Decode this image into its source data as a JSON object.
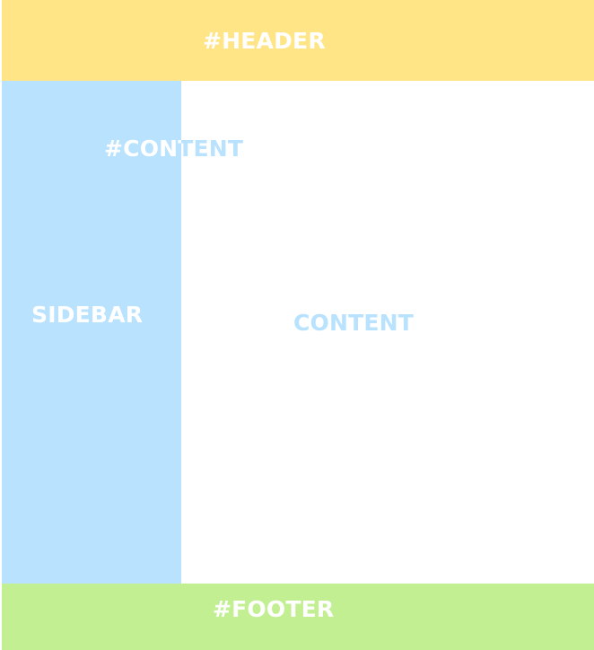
{
  "header": {
    "label": "#HEADER",
    "color": "#ffe585"
  },
  "sidebar": {
    "label": "SIDEBAR",
    "color": "#b8e2fe"
  },
  "content": {
    "id_label": "#CONTENT",
    "label": "CONTENT",
    "color": "#ffffff"
  },
  "footer": {
    "label": "#FOOTER",
    "color": "#c2ef92"
  }
}
